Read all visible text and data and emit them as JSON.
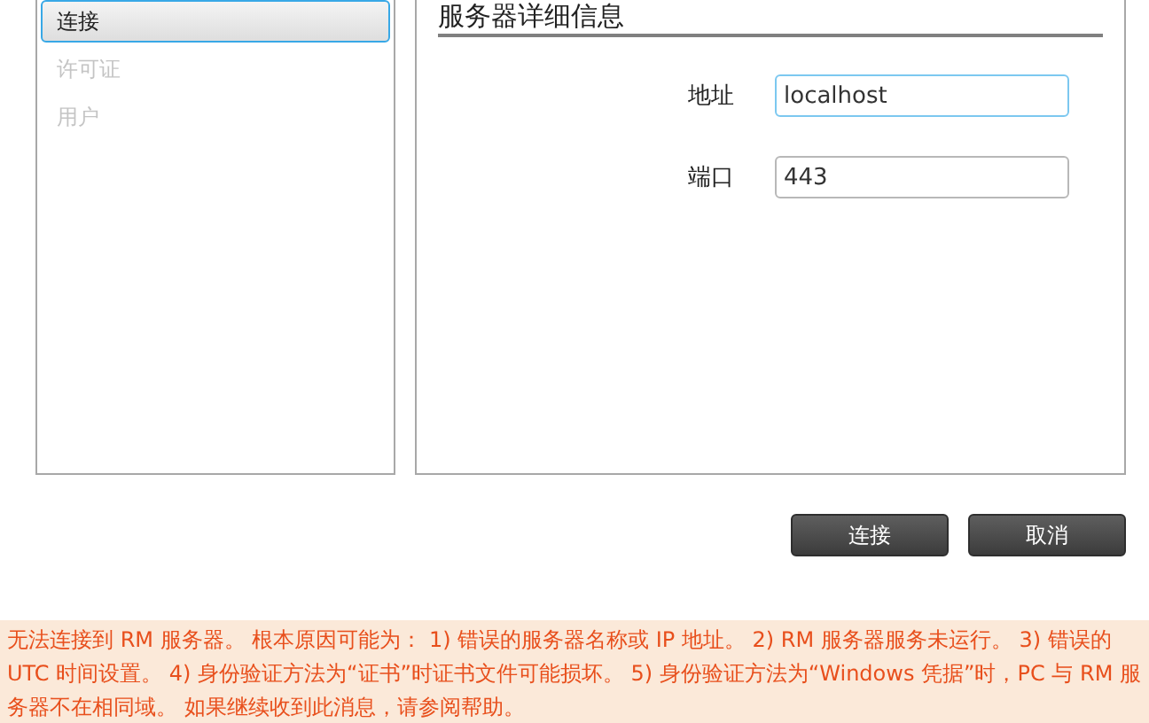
{
  "sidebar": {
    "items": [
      {
        "label": "连接",
        "selected": true
      },
      {
        "label": "许可证",
        "selected": false
      },
      {
        "label": "用户",
        "selected": false
      }
    ]
  },
  "details": {
    "title": "服务器详细信息",
    "fields": [
      {
        "label": "地址",
        "value": "localhost",
        "focused": true
      },
      {
        "label": "端口",
        "value": "443",
        "focused": false
      }
    ]
  },
  "buttons": [
    "连接",
    "取消"
  ],
  "error": "无法连接到 RM 服务器。 根本原因可能为： 1) 错误的服务器名称或 IP 地址。 2) RM 服务器服务未运行。 3) 错误的 UTC 时间设置。 4) 身份验证方法为“证书”时证书文件可能损坏。 5) 身份验证方法为“Windows 凭据”时，PC 与 RM 服务器不在相同域。 如果继续收到此消息，请参阅帮助。"
}
